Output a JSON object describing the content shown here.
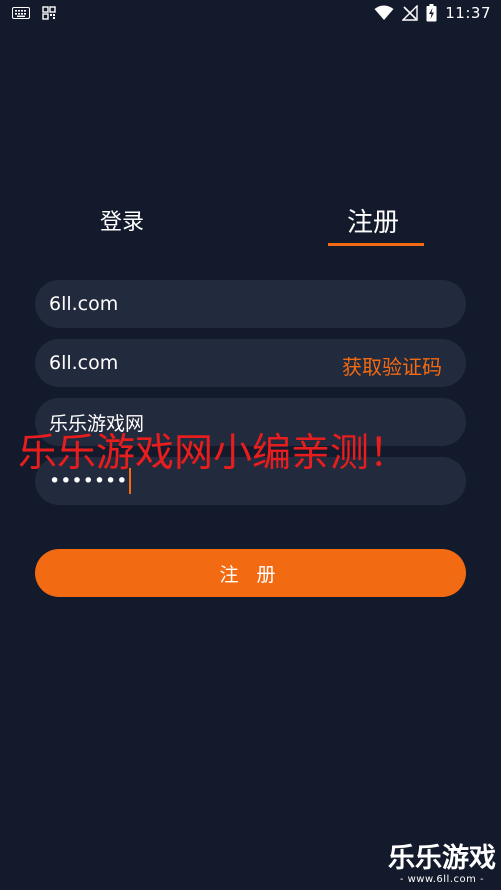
{
  "status_bar": {
    "time": "11:37",
    "left_icons": [
      "keyboard-icon",
      "qr-scan-icon"
    ],
    "right_icons": [
      "wifi-icon",
      "no-signal-icon",
      "battery-icon"
    ]
  },
  "tabs": {
    "login_label": "登录",
    "register_label": "注册",
    "active": "register"
  },
  "form": {
    "phone_value": "6ll.com",
    "code_value": "6ll.com",
    "get_code_label": "获取验证码",
    "nickname_value": "乐乐游戏网",
    "password_masked": "•••••••"
  },
  "register_button_label": "注 册",
  "watermark": {
    "caption": "乐乐游戏网小编亲测！",
    "logo_text": "乐乐游戏",
    "logo_url": "- www.6ll.com -"
  },
  "colors": {
    "background": "#131a2c",
    "field": "#222a3d",
    "accent": "#f26a12",
    "watermark_red": "#e81d1d"
  }
}
